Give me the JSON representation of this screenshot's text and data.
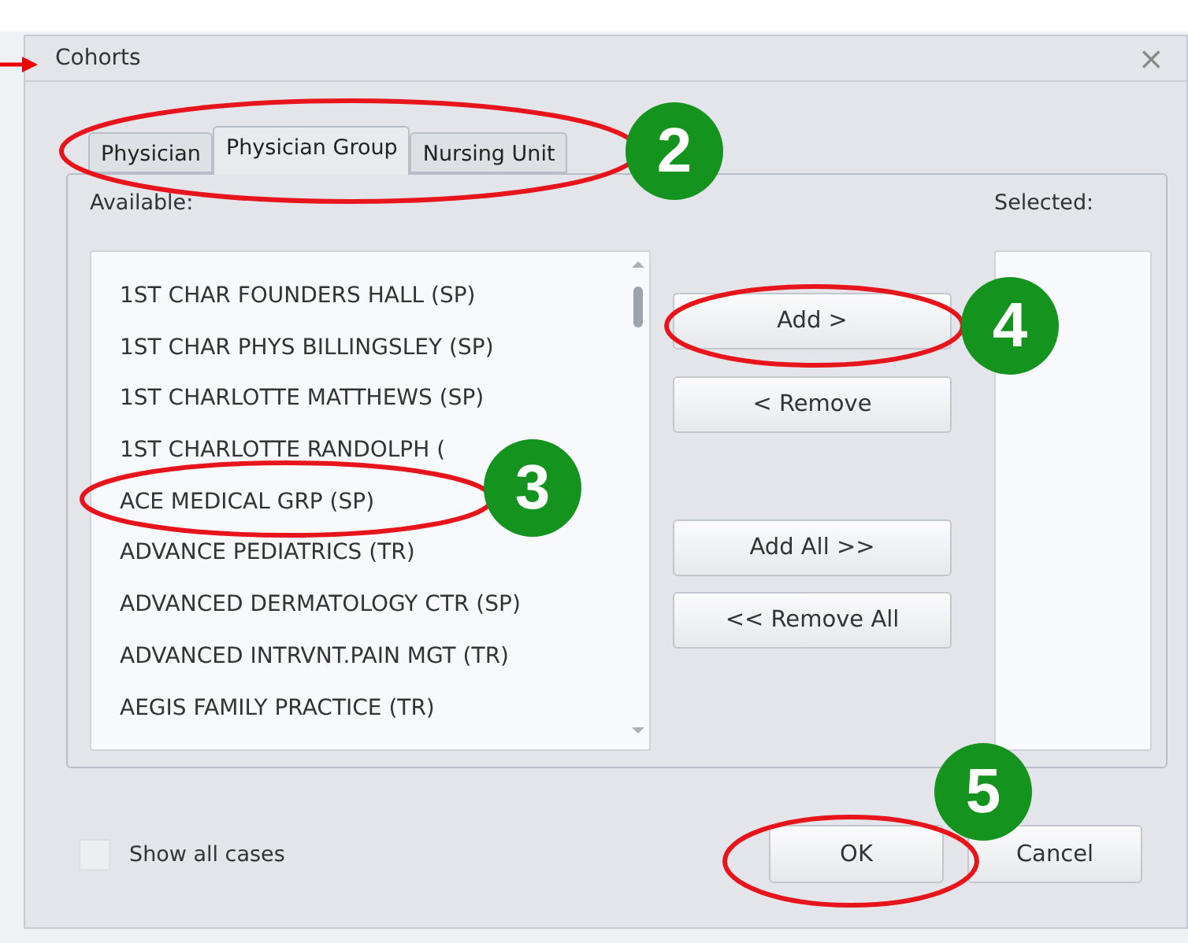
{
  "window": {
    "title": "Cohorts",
    "close": "×"
  },
  "tabs": [
    {
      "label": "Physician",
      "selected": false
    },
    {
      "label": "Physician Group",
      "selected": true
    },
    {
      "label": "Nursing Unit",
      "selected": false
    }
  ],
  "available": {
    "label": "Available:",
    "items": [
      "1ST CHAR FOUNDERS HALL (SP)",
      "1ST CHAR PHYS BILLINGSLEY (SP)",
      "1ST CHARLOTTE MATTHEWS (SP)",
      "1ST CHARLOTTE RANDOLPH (",
      "ACE MEDICAL GRP (SP)",
      "ADVANCE PEDIATRICS (TR)",
      "ADVANCED DERMATOLOGY CTR (SP)",
      "ADVANCED INTRVNT.PAIN MGT (TR)",
      "AEGIS FAMILY PRACTICE (TR)"
    ]
  },
  "move_buttons": [
    "Add >",
    "< Remove",
    "Add All >>",
    "<< Remove All"
  ],
  "selected": {
    "label": "Selected:"
  },
  "show_all_cases": {
    "label": "Show all cases",
    "checked": false
  },
  "buttons": [
    "OK",
    "Cancel"
  ],
  "callouts": [
    {
      "number": "2"
    },
    {
      "number": "3"
    },
    {
      "number": "4"
    },
    {
      "number": "5"
    }
  ]
}
